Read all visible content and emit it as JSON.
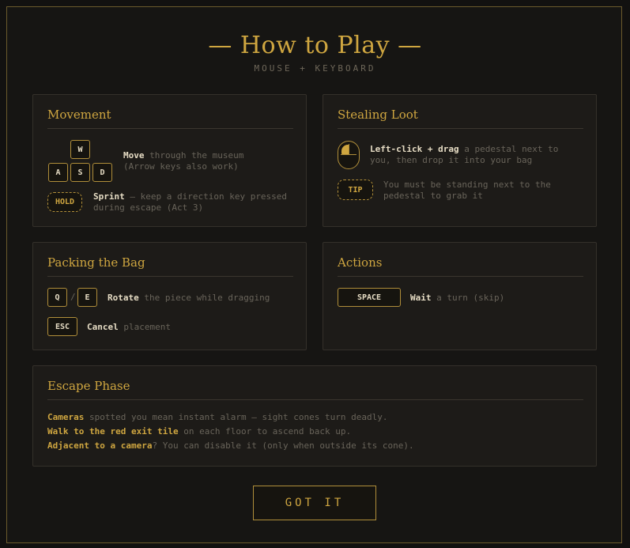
{
  "header": {
    "title": "— How to Play —",
    "subtitle": "MOUSE + KEYBOARD"
  },
  "movement": {
    "title": "Movement",
    "keys": {
      "w": "W",
      "a": "A",
      "s": "S",
      "d": "D",
      "hold": "HOLD"
    },
    "move_label": "Move",
    "move_desc_1": " through the museum",
    "move_desc_2": "(Arrow keys also work)",
    "sprint_label": "Sprint",
    "sprint_desc_1": " — keep a direction key pressed",
    "sprint_desc_2": "during escape (Act 3)"
  },
  "stealing": {
    "title": "Stealing Loot",
    "action_label": "Left-click + drag",
    "action_desc_1": " a pedestal next to",
    "action_desc_2": "you, then drop it into your bag",
    "tip_key": "TIP",
    "tip_desc_1": "You must be standing next to the",
    "tip_desc_2": "pedestal to grab it"
  },
  "packing": {
    "title": "Packing the Bag",
    "keys": {
      "q": "Q",
      "e": "E",
      "esc": "ESC"
    },
    "separator": "/",
    "rotate_label": "Rotate",
    "rotate_desc": " the piece while dragging",
    "cancel_label": "Cancel",
    "cancel_desc": " placement"
  },
  "actions": {
    "title": "Actions",
    "space_key": "SPACE",
    "wait_label": "Wait",
    "wait_desc": " a turn (skip)"
  },
  "escape": {
    "title": "Escape Phase",
    "lines": [
      {
        "hl": "Cameras",
        "rest": " spotted you mean instant alarm — sight cones turn deadly."
      },
      {
        "hl": "Walk to the red exit tile",
        "rest": " on each floor to ascend back up."
      },
      {
        "hl": "Adjacent to a camera",
        "rest": "? You can disable it (only when outside its cone)."
      }
    ]
  },
  "footer": {
    "button_label": "GOT IT"
  },
  "colors": {
    "accent": "#cfa640",
    "background": "#121110",
    "panel": "#1d1b18"
  },
  "icons": {
    "mouse": "mouse-left-click-icon"
  }
}
